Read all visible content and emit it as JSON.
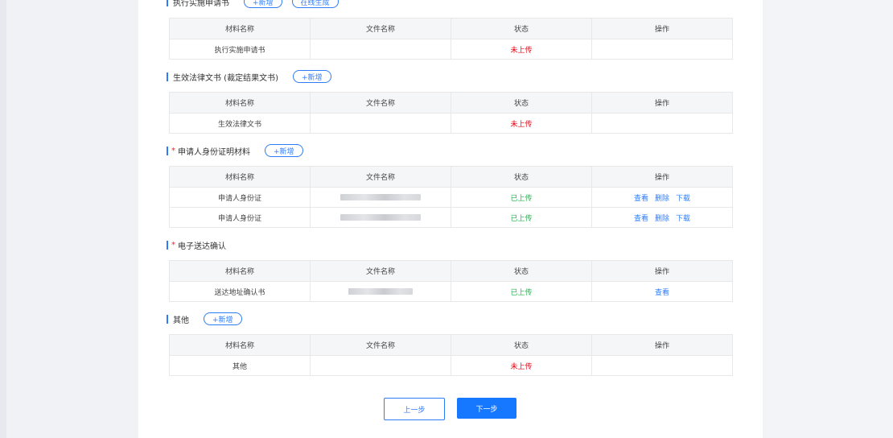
{
  "sections": [
    {
      "title": "执行实施申请书",
      "required": false,
      "add_label": "+新增",
      "extra_label": "在线生成",
      "headers": [
        "材料名称",
        "文件名称",
        "状态",
        "操作"
      ],
      "rows": [
        {
          "name": "执行实施申请书",
          "file": "",
          "status": "未上传",
          "status_color": "red",
          "ops": []
        }
      ]
    },
    {
      "title": "生效法律文书 (裁定结果文书)",
      "required": false,
      "add_label": "+新增",
      "headers": [
        "材料名称",
        "文件名称",
        "状态",
        "操作"
      ],
      "rows": [
        {
          "name": "生效法律文书",
          "file": "",
          "status": "未上传",
          "status_color": "red",
          "ops": []
        }
      ]
    },
    {
      "title": "申请人身份证明材料",
      "required": true,
      "add_label": "+新增",
      "headers": [
        "材料名称",
        "文件名称",
        "状态",
        "操作"
      ],
      "rows": [
        {
          "name": "申请人身份证",
          "file": "blurred",
          "status": "已上传",
          "status_color": "green",
          "ops": [
            "查看",
            "删除",
            "下载"
          ]
        },
        {
          "name": "申请人身份证",
          "file": "blurred",
          "status": "已上传",
          "status_color": "green",
          "ops": [
            "查看",
            "删除",
            "下载"
          ]
        }
      ]
    },
    {
      "title": "电子送达确认",
      "required": true,
      "headers": [
        "材料名称",
        "文件名称",
        "状态",
        "操作"
      ],
      "rows": [
        {
          "name": "送达地址确认书",
          "file": "blurred",
          "status": "已上传",
          "status_color": "green",
          "ops": [
            "查看"
          ]
        }
      ]
    },
    {
      "title": "其他",
      "required": false,
      "add_label": "+新增",
      "headers": [
        "材料名称",
        "文件名称",
        "状态",
        "操作"
      ],
      "rows": [
        {
          "name": "其他",
          "file": "",
          "status": "未上传",
          "status_color": "red",
          "ops": []
        }
      ]
    }
  ],
  "footer": {
    "prev_label": "上一步",
    "next_label": "下一步"
  },
  "colors": {
    "accent": "#2f7cf6",
    "primary_button": "#1677ff",
    "status_not_uploaded": "#e60012",
    "status_uploaded": "#22b14c"
  }
}
